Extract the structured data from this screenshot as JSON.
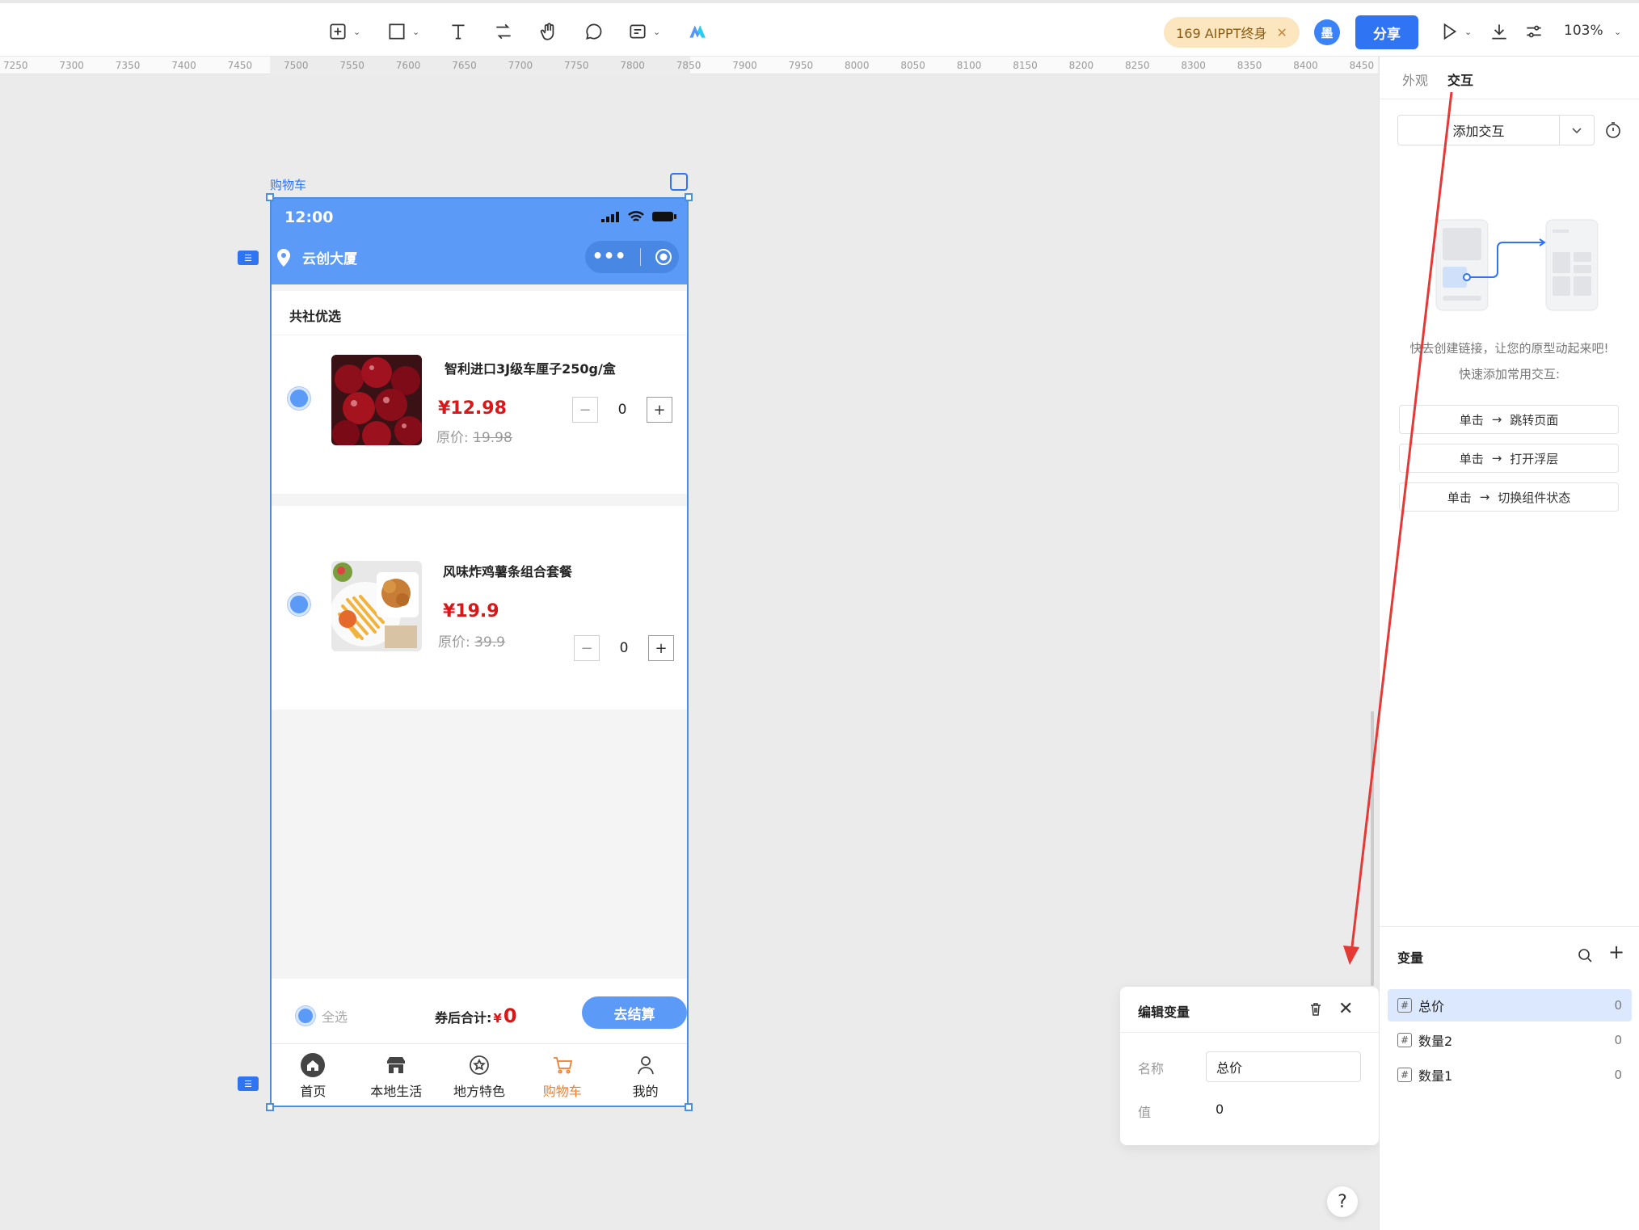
{
  "toolbar": {
    "promo_text": "169 AIPPT终身",
    "user_badge": "墨",
    "share_label": "分享",
    "zoom": "103%"
  },
  "ruler": {
    "ticks": [
      "7250",
      "7300",
      "7350",
      "7400",
      "7450",
      "7500",
      "7550",
      "7600",
      "7650",
      "7700",
      "7750",
      "7800",
      "7850",
      "7900",
      "7950",
      "8000",
      "8050",
      "8100",
      "8150",
      "8200",
      "8250",
      "8300",
      "8350",
      "8400",
      "8450"
    ]
  },
  "frame": {
    "label": "购物车"
  },
  "phone": {
    "time": "12:00",
    "location": "云创大厦",
    "section_title": "共社优选",
    "items": [
      {
        "name": "智利进口3J级车厘子250g/盒",
        "price": "¥12.98",
        "orig_label": "原价:",
        "orig_price": "19.98",
        "qty": "0"
      },
      {
        "name": "风味炸鸡薯条组合套餐",
        "price": "¥19.9",
        "orig_label": "原价:",
        "orig_price": "39.9",
        "qty": "0"
      }
    ],
    "select_all": "全选",
    "total_label": "券后合计:",
    "total_currency": "¥",
    "total_value": "0",
    "checkout": "去结算",
    "tabs": [
      {
        "label": "首页",
        "icon": "home-icon"
      },
      {
        "label": "本地生活",
        "icon": "store-icon"
      },
      {
        "label": "地方特色",
        "icon": "star-badge-icon"
      },
      {
        "label": "购物车",
        "icon": "cart-icon"
      },
      {
        "label": "我的",
        "icon": "user-icon"
      }
    ]
  },
  "popup": {
    "title": "编辑变量",
    "name_label": "名称",
    "name_value": "总价",
    "value_label": "值",
    "value": "0"
  },
  "help": "?",
  "panel": {
    "tab_appearance": "外观",
    "tab_interaction": "交互",
    "add_interaction": "添加交互",
    "hint1": "快去创建链接，让您的原型动起来吧!",
    "hint2": "快速添加常用交互:",
    "quick": [
      {
        "trigger": "单击",
        "action": "跳转页面"
      },
      {
        "trigger": "单击",
        "action": "打开浮层"
      },
      {
        "trigger": "单击",
        "action": "切换组件状态"
      }
    ],
    "vars_title": "变量",
    "variables": [
      {
        "name": "总价",
        "value": "0"
      },
      {
        "name": "数量2",
        "value": "0"
      },
      {
        "name": "数量1",
        "value": "0"
      }
    ]
  },
  "colors": {
    "primary": "#2f74f3",
    "header_blue": "#5b9bf7",
    "price_red": "#d81818",
    "tab_active": "#f07d2b",
    "annotation_red": "#e53935"
  }
}
